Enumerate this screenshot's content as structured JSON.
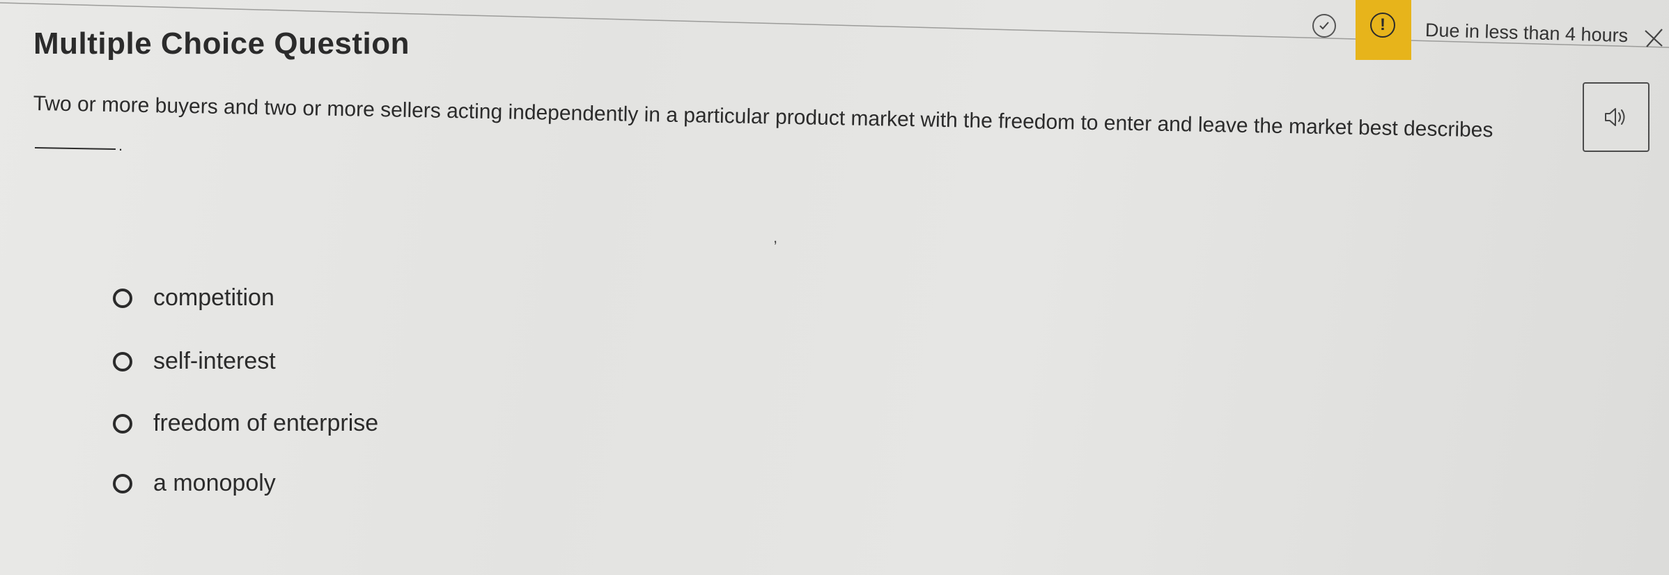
{
  "question": {
    "title": "Multiple Choice Question",
    "text": "Two or more buyers and two or more sellers acting independently in a particular product market with the freedom to enter and leave the market best describes",
    "blank_suffix": ".",
    "stray_mark": ","
  },
  "status": {
    "due_text": "Due in less than 4 hours",
    "alert_symbol": "!",
    "alert_color": "#e7b41b"
  },
  "icons": {
    "check": "check-circle-icon",
    "alert": "exclamation-circle-icon",
    "close": "close-icon",
    "audio": "speaker-icon",
    "radio": "radio-icon"
  },
  "options": [
    {
      "label": "competition",
      "selected": false
    },
    {
      "label": "self-interest",
      "selected": false
    },
    {
      "label": "freedom of enterprise",
      "selected": false
    },
    {
      "label": "a monopoly",
      "selected": false
    }
  ]
}
